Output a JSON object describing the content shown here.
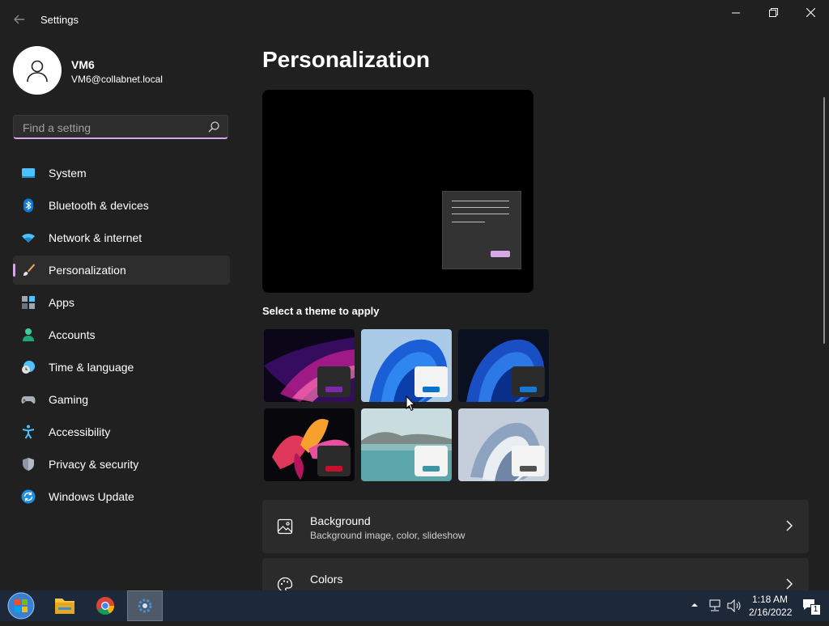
{
  "window": {
    "title": "Settings",
    "controls": {
      "minimize": "minimize-icon",
      "maximize": "restore-icon",
      "close": "close-icon"
    }
  },
  "profile": {
    "name": "VM6",
    "email": "VM6@collabnet.local"
  },
  "search": {
    "placeholder": "Find a setting",
    "value": ""
  },
  "sidebar": {
    "active_index": 3,
    "items": [
      {
        "label": "System",
        "icon": "system-icon"
      },
      {
        "label": "Bluetooth & devices",
        "icon": "bluetooth-icon"
      },
      {
        "label": "Network & internet",
        "icon": "wifi-icon"
      },
      {
        "label": "Personalization",
        "icon": "brush-icon"
      },
      {
        "label": "Apps",
        "icon": "apps-icon"
      },
      {
        "label": "Accounts",
        "icon": "accounts-icon"
      },
      {
        "label": "Time & language",
        "icon": "clock-globe-icon"
      },
      {
        "label": "Gaming",
        "icon": "gamepad-icon"
      },
      {
        "label": "Accessibility",
        "icon": "accessibility-icon"
      },
      {
        "label": "Privacy & security",
        "icon": "shield-icon"
      },
      {
        "label": "Windows Update",
        "icon": "update-icon"
      }
    ]
  },
  "main": {
    "title": "Personalization",
    "themes_label": "Select a theme to apply",
    "themes": [
      {
        "name": "glow-dark",
        "accent": "#7e2aa8"
      },
      {
        "name": "bloom-light",
        "accent": "#0a73c9"
      },
      {
        "name": "bloom-dark",
        "accent": "#1877d2"
      },
      {
        "name": "captured-motion",
        "accent": "#c8102e"
      },
      {
        "name": "sunrise-lake",
        "accent": "#3f95a5"
      },
      {
        "name": "flow-light",
        "accent": "#505050"
      }
    ],
    "settings": [
      {
        "title": "Background",
        "subtitle": "Background image, color, slideshow",
        "icon": "image-icon"
      },
      {
        "title": "Colors",
        "subtitle": "",
        "icon": "palette-icon"
      }
    ]
  },
  "taskbar": {
    "apps": [
      "start-orb",
      "file-explorer",
      "chrome",
      "settings"
    ],
    "time": "1:18 AM",
    "date": "2/16/2022",
    "notification_count": "1"
  },
  "colors": {
    "accent": "#d7a7e8",
    "background": "#202020",
    "taskbar": "#1d2838"
  }
}
